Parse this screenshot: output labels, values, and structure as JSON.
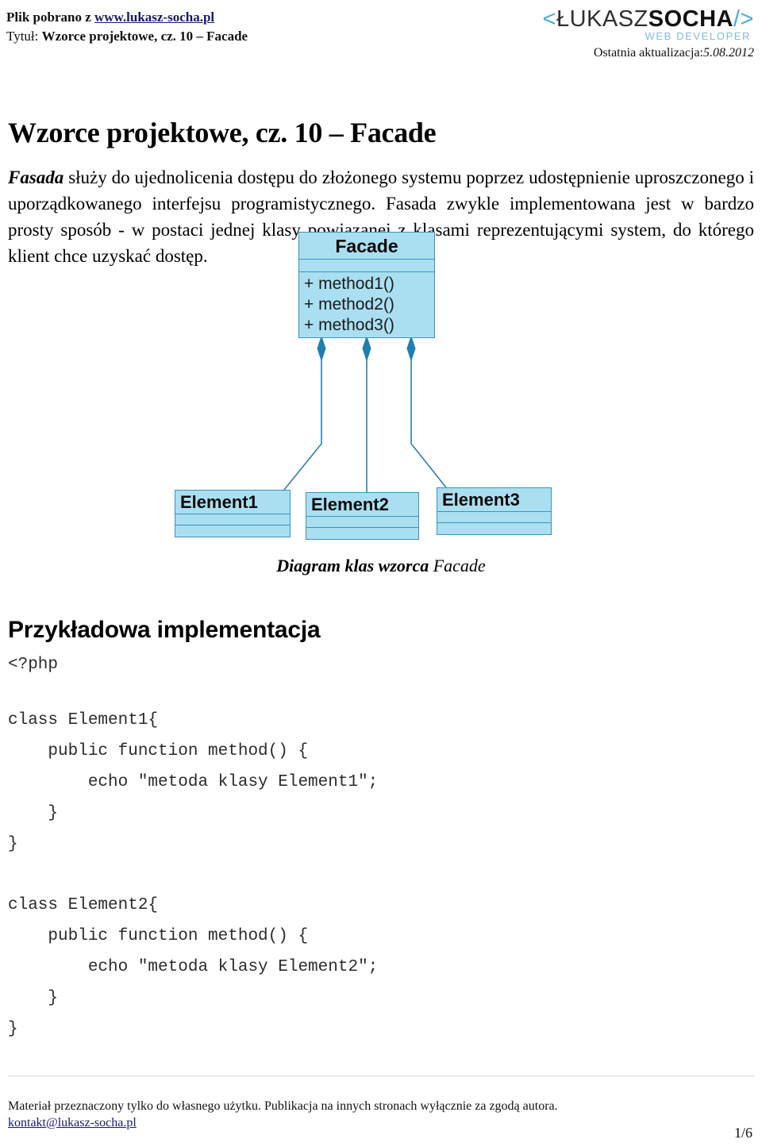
{
  "header": {
    "downloaded_from_label": "Plik pobrano z ",
    "site_link": "www.lukasz-socha.pl",
    "title_label": "Tytuł: ",
    "title_value": "Wzorce projektowe, cz. 10 – Facade",
    "logo": {
      "bracket_open": "<",
      "name_light": "ŁUKASZ",
      "name_bold": "SOCHA",
      "bracket_close": "/>",
      "tagline": "WEB DEVELOPER",
      "update_label": "Ostatnia aktualizacja:",
      "update_date": "5.08.2012"
    }
  },
  "document": {
    "title": "Wzorce projektowe, cz. 10 – Facade",
    "intro_term": "Fasada",
    "intro_text": " służy do ujednolicenia dostępu do złożonego systemu poprzez udostępnienie uproszczonego i uporządkowanego interfejsu programistycznego. Fasada zwykle implementowana jest w bardzo prosty sposób - w postaci jednej klasy powiązanej z klasami reprezentującymi system, do którego klient chce uzyskać dostęp.",
    "caption_italic": "Diagram klas wzorca ",
    "caption_tail": "Facade",
    "section_heading": "Przykładowa implementacja"
  },
  "diagram": {
    "fill_color": "#aadff1",
    "stroke_color": "#3b93bd",
    "diamond_color": "#1f7fb0",
    "facade": {
      "name": "Facade",
      "methods": [
        "+ method1()",
        "+ method2()",
        "+ method3()"
      ]
    },
    "elements": [
      {
        "name": "Element1"
      },
      {
        "name": "Element2"
      },
      {
        "name": "Element3"
      }
    ]
  },
  "code": {
    "open_tag": "<?php",
    "block1": "class Element1{\n    public function method() {\n        echo \"metoda klasy Element1\";\n    }\n}",
    "block2": "class Element2{\n    public function method() {\n        echo \"metoda klasy Element2\";\n    }\n}"
  },
  "footer": {
    "notice": "Materiał przeznaczony tylko do własnego użytku. Publikacja na innych stronach wyłącznie za zgodą autora.",
    "email": "kontakt@lukasz-socha.pl",
    "page_number": "1/6"
  }
}
